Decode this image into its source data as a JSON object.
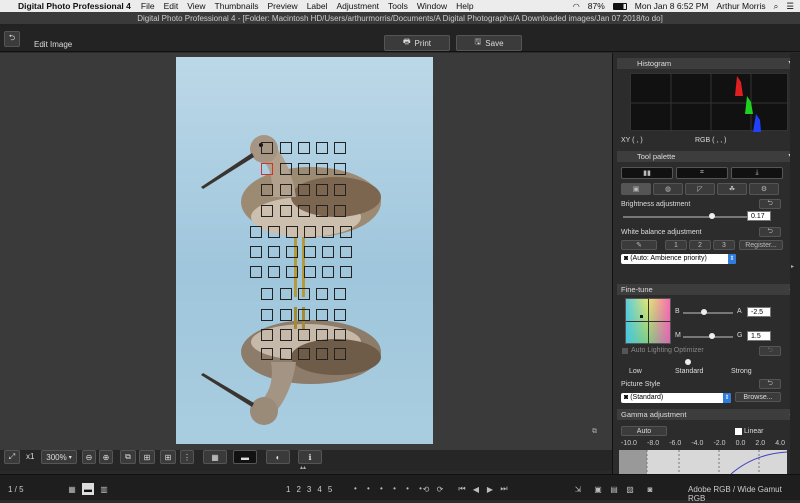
{
  "menubar": {
    "app_name": "Digital Photo Professional 4",
    "items": [
      "File",
      "Edit",
      "View",
      "Thumbnails",
      "Preview",
      "Label",
      "Adjustment",
      "Tools",
      "Window",
      "Help"
    ],
    "battery": "87%",
    "datetime": "Mon Jan 8  6:52 PM",
    "user": "Arthur Morris"
  },
  "window": {
    "title": "Digital Photo Professional 4 - [Folder: Macintosh HD/Users/arthurmorris/Documents/A Digital Photographs/A Downloaded images/Jan 07 2018/to do]"
  },
  "toolbar": {
    "mode_label": "Edit Image",
    "print_label": "Print",
    "save_label": "Save"
  },
  "view": {
    "zoom_preset": "x1",
    "zoom_value": "300%",
    "page_indicator": "1 / 5",
    "star_labels": [
      "1",
      "2",
      "3",
      "4",
      "5"
    ],
    "color_space": "Adobe RGB / Wide Gamut RGB"
  },
  "histogram": {
    "title": "Histogram",
    "xy_label": "XY (          ,          )",
    "rgb_label": "RGB (       ,       ,       )"
  },
  "tool_palette": {
    "title": "Tool palette",
    "brightness_label": "Brightness adjustment",
    "brightness_value": "0.17",
    "brightness_fraction": 0.72,
    "wb_label": "White balance adjustment",
    "wb_presets": [
      "1",
      "2",
      "3"
    ],
    "register_label": "Register...",
    "wb_select": "(Auto: Ambience priority)"
  },
  "fine_tune": {
    "title": "Fine-tune",
    "b_label": "B",
    "a_label": "A",
    "a_value": "-2.5",
    "m_label": "M",
    "g_label": "G",
    "g_value": "1.5",
    "alo_label": "Auto Lighting Optimizer",
    "alo_levels": [
      "Low",
      "Standard",
      "Strong"
    ],
    "picture_style_label": "Picture Style",
    "picture_style_value": "(Standard)",
    "browse_label": "Browse..."
  },
  "gamma": {
    "title": "Gamma adjustment",
    "auto_label": "Auto",
    "linear_label": "Linear",
    "scale": [
      "-10.0",
      "-8.0",
      "-6.0",
      "-4.0",
      "-2.0",
      "0.0",
      "2.0",
      "4.0"
    ]
  },
  "colors": {
    "accent": "#2f7bde",
    "panel_bg": "#2c2c2c",
    "canvas_bg": "#3a3a3a",
    "af_point": "#222222",
    "af_point_active": "#cc3333"
  }
}
